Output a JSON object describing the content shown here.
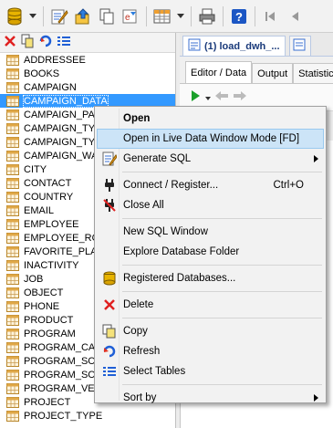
{
  "toolbar": {
    "icons": [
      "database-icon",
      "dropdown-arrow-icon",
      "edit-icon",
      "export-icon",
      "copy-icon",
      "sql-edit-icon",
      "grid-icon",
      "dropdown-arrow-icon",
      "print-icon",
      "help-icon",
      "first-record-icon",
      "prev-record-icon"
    ]
  },
  "left_toolbar": {
    "icons": [
      "close-icon",
      "copy-icon",
      "refresh-icon",
      "select-tables-icon"
    ]
  },
  "tree": {
    "items": [
      "ADDRESSEE",
      "BOOKS",
      "CAMPAIGN",
      "CAMPAIGN_DATA",
      "CAMPAIGN_PAR",
      "CAMPAIGN_TYP",
      "CAMPAIGN_TYP",
      "CAMPAIGN_WA",
      "CITY",
      "CONTACT",
      "COUNTRY",
      "EMAIL",
      "EMPLOYEE",
      "EMPLOYEE_ROL",
      "FAVORITE_PLA",
      "INACTIVITY",
      "JOB",
      "OBJECT",
      "PHONE",
      "PRODUCT",
      "PROGRAM",
      "PROGRAM_CAT",
      "PROGRAM_SCR",
      "PROGRAM_SCR",
      "PROGRAM_VER",
      "PROJECT",
      "PROJECT_TYPE"
    ],
    "selected_index": 3
  },
  "right": {
    "doc_tab": "(1) load_dwh_...",
    "sub_tabs": [
      "Editor / Data",
      "Output",
      "Statistic"
    ],
    "active_sub_tab": 0
  },
  "context_menu": {
    "items": [
      {
        "label": "Open",
        "bold": true,
        "icon": ""
      },
      {
        "label": "Open in Live Data Window Mode [FD]",
        "highlight": true,
        "icon": ""
      },
      {
        "label": "Generate SQL",
        "submenu": true,
        "icon": "generate-sql-icon"
      },
      {
        "sep": true
      },
      {
        "label": "Connect / Register...",
        "shortcut": "Ctrl+O",
        "icon": "connect-plug-icon"
      },
      {
        "label": "Close All",
        "icon": "disconnect-plug-icon"
      },
      {
        "sep": true
      },
      {
        "label": "New SQL Window",
        "icon": ""
      },
      {
        "label": "Explore Database Folder",
        "icon": ""
      },
      {
        "sep": true
      },
      {
        "label": "Registered Databases...",
        "icon": "database-icon"
      },
      {
        "sep": true
      },
      {
        "label": "Delete",
        "icon": "delete-x-icon"
      },
      {
        "sep": true
      },
      {
        "label": "Copy",
        "icon": "copy-icon"
      },
      {
        "label": "Refresh",
        "icon": "refresh-icon"
      },
      {
        "label": "Select Tables",
        "icon": "select-tables-icon"
      },
      {
        "sep": true
      },
      {
        "label": "Sort by",
        "submenu": true,
        "icon": ""
      }
    ]
  },
  "colors": {
    "selection": "#3399ff",
    "menu_highlight": "#cce4f7"
  }
}
